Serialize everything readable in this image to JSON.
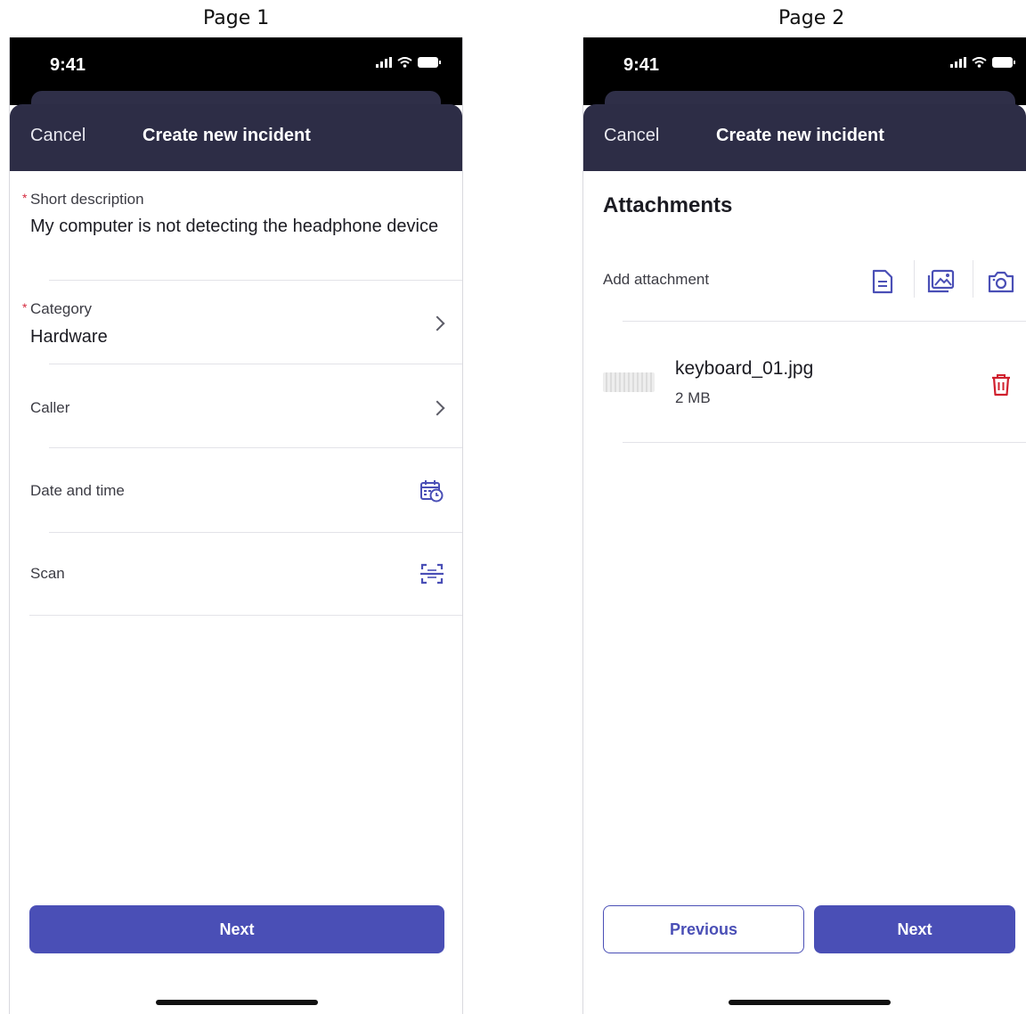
{
  "page_labels": [
    "Page 1",
    "Page 2"
  ],
  "status": {
    "time": "9:41"
  },
  "nav": {
    "cancel": "Cancel",
    "title": "Create new incident"
  },
  "page1": {
    "fields": [
      {
        "label": "Short description",
        "required": true,
        "value": "My computer is not detecting the headphone device"
      },
      {
        "label": "Category",
        "required": true,
        "value": "Hardware"
      },
      {
        "label": "Caller",
        "required": false,
        "value": ""
      },
      {
        "label": "Date and time",
        "required": false,
        "icon": "calendar-clock-icon"
      },
      {
        "label": "Scan",
        "required": false,
        "icon": "scan-icon"
      }
    ],
    "next_label": "Next"
  },
  "page2": {
    "section_title": "Attachments",
    "add_label": "Add attachment",
    "attachment_icons": [
      "document-icon",
      "image-icon",
      "camera-icon"
    ],
    "attachment": {
      "name": "keyboard_01.jpg",
      "size": "2 MB"
    },
    "previous_label": "Previous",
    "next_label": "Next"
  },
  "colors": {
    "accent": "#4a4fb6",
    "nav_bg": "#2d2d46",
    "required": "#d52b3f",
    "delete": "#d0202e"
  }
}
